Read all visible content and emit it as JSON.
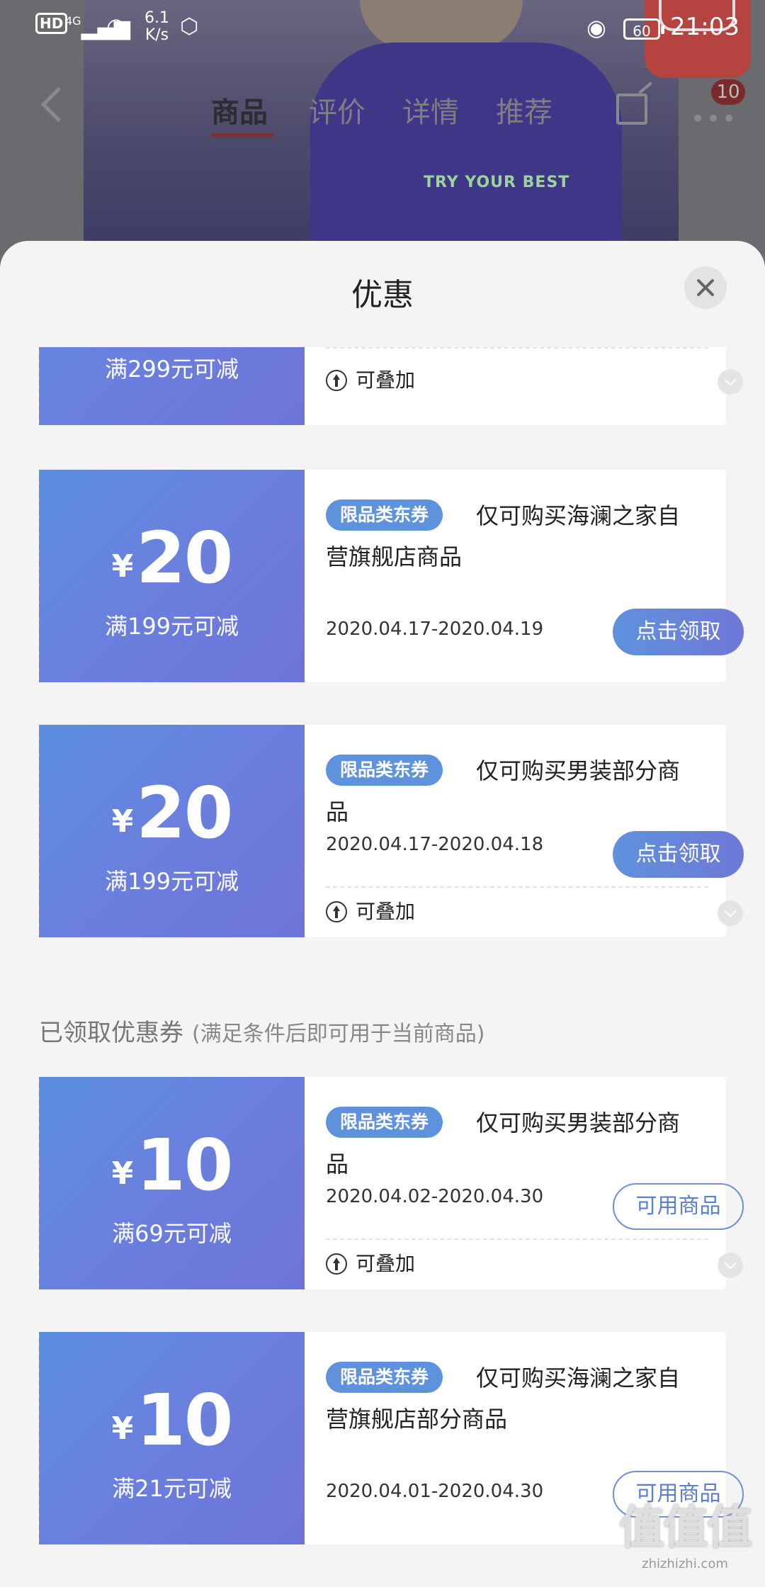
{
  "status_bar": {
    "network_hd": "HD",
    "network_gen": "4G",
    "speed_value": "6.1",
    "speed_unit": "K/s",
    "battery": "60",
    "time": "21:03"
  },
  "product_page": {
    "tabs": [
      "商品",
      "评价",
      "详情",
      "推荐"
    ],
    "active_tab": "商品",
    "cart_badge": "10",
    "shirt_text": "TRY YOUR BEST"
  },
  "sheet": {
    "title": "优惠",
    "section_received": {
      "title": "已领取优惠券",
      "subtitle": "(满足条件后即可用于当前商品)"
    },
    "coupons": [
      {
        "condition": "满299元可减",
        "stackable": "可叠加"
      },
      {
        "currency": "¥",
        "amount": "20",
        "condition": "满199元可减",
        "tag": "限品类东券",
        "description": "仅可购买海澜之家自营旗舰店商品",
        "date": "2020.04.17-2020.04.19",
        "button": "点击领取"
      },
      {
        "currency": "¥",
        "amount": "20",
        "condition": "满199元可减",
        "tag": "限品类东券",
        "description": "仅可购买男装部分商品",
        "date": "2020.04.17-2020.04.18",
        "button": "点击领取",
        "stackable": "可叠加"
      },
      {
        "currency": "¥",
        "amount": "10",
        "condition": "满69元可减",
        "tag": "限品类东券",
        "description": "仅可购买男装部分商品",
        "date": "2020.04.02-2020.04.30",
        "button": "可用商品",
        "stackable": "可叠加"
      },
      {
        "currency": "¥",
        "amount": "10",
        "condition": "满21元可减",
        "tag": "限品类东券",
        "description": "仅可购买海澜之家自营旗舰店部分商品",
        "date": "2020.04.01-2020.04.30",
        "button": "可用商品"
      }
    ]
  },
  "watermark": {
    "logo": "值值值",
    "url": "zhizhizhi.com"
  },
  "colors": {
    "coupon_gradient_start": "#5b8fe0",
    "coupon_gradient_end": "#6e74d8",
    "tag_bg": "#5f92dc",
    "sheet_bg": "#f4f4f5"
  }
}
